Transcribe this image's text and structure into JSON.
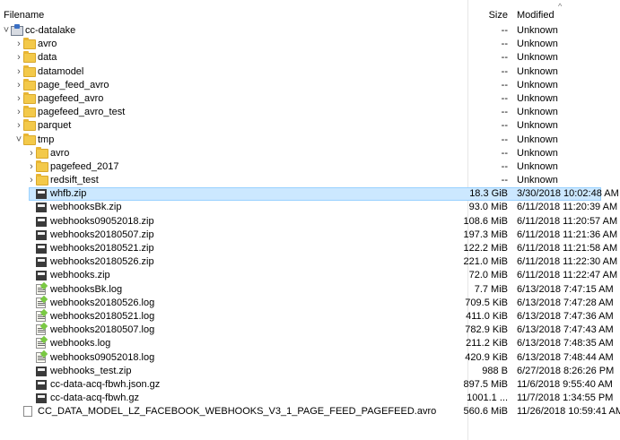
{
  "header": {
    "filename_label": "Filename",
    "size_label": "Size",
    "modified_label": "Modified",
    "sort_indicator": "^"
  },
  "rows": [
    {
      "depth": 0,
      "expand": "down",
      "icon": "drive-icon",
      "name": "cc-datalake",
      "size": "--",
      "modified": "Unknown"
    },
    {
      "depth": 1,
      "expand": "right",
      "icon": "folder-icon",
      "name": "avro",
      "size": "--",
      "modified": "Unknown"
    },
    {
      "depth": 1,
      "expand": "right",
      "icon": "folder-icon",
      "name": "data",
      "size": "--",
      "modified": "Unknown"
    },
    {
      "depth": 1,
      "expand": "right",
      "icon": "folder-icon",
      "name": "datamodel",
      "size": "--",
      "modified": "Unknown"
    },
    {
      "depth": 1,
      "expand": "right",
      "icon": "folder-icon",
      "name": "page_feed_avro",
      "size": "--",
      "modified": "Unknown"
    },
    {
      "depth": 1,
      "expand": "right",
      "icon": "folder-icon",
      "name": "pagefeed_avro",
      "size": "--",
      "modified": "Unknown"
    },
    {
      "depth": 1,
      "expand": "right",
      "icon": "folder-icon",
      "name": "pagefeed_avro_test",
      "size": "--",
      "modified": "Unknown"
    },
    {
      "depth": 1,
      "expand": "right",
      "icon": "folder-icon",
      "name": "parquet",
      "size": "--",
      "modified": "Unknown"
    },
    {
      "depth": 1,
      "expand": "down",
      "icon": "folder-icon",
      "name": "tmp",
      "size": "--",
      "modified": "Unknown"
    },
    {
      "depth": 2,
      "expand": "right",
      "icon": "folder-icon",
      "name": "avro",
      "size": "--",
      "modified": "Unknown"
    },
    {
      "depth": 2,
      "expand": "right",
      "icon": "folder-icon",
      "name": "pagefeed_2017",
      "size": "--",
      "modified": "Unknown"
    },
    {
      "depth": 2,
      "expand": "right",
      "icon": "folder-icon",
      "name": "redsift_test",
      "size": "--",
      "modified": "Unknown"
    },
    {
      "depth": 2,
      "expand": "",
      "icon": "zip-icon",
      "name": "whfb.zip",
      "size": "18.3 GiB",
      "modified": "3/30/2018 10:02:48 AM",
      "selected": true
    },
    {
      "depth": 2,
      "expand": "",
      "icon": "zip-icon",
      "name": "webhooksBk.zip",
      "size": "93.0 MiB",
      "modified": "6/11/2018 11:20:39 AM"
    },
    {
      "depth": 2,
      "expand": "",
      "icon": "zip-icon",
      "name": "webhooks09052018.zip",
      "size": "108.6 MiB",
      "modified": "6/11/2018 11:20:57 AM"
    },
    {
      "depth": 2,
      "expand": "",
      "icon": "zip-icon",
      "name": "webhooks20180507.zip",
      "size": "197.3 MiB",
      "modified": "6/11/2018 11:21:36 AM"
    },
    {
      "depth": 2,
      "expand": "",
      "icon": "zip-icon",
      "name": "webhooks20180521.zip",
      "size": "122.2 MiB",
      "modified": "6/11/2018 11:21:58 AM"
    },
    {
      "depth": 2,
      "expand": "",
      "icon": "zip-icon",
      "name": "webhooks20180526.zip",
      "size": "221.0 MiB",
      "modified": "6/11/2018 11:22:30 AM"
    },
    {
      "depth": 2,
      "expand": "",
      "icon": "zip-icon",
      "name": "webhooks.zip",
      "size": "72.0 MiB",
      "modified": "6/11/2018 11:22:47 AM"
    },
    {
      "depth": 2,
      "expand": "",
      "icon": "log-icon",
      "name": "webhooksBk.log",
      "size": "7.7 MiB",
      "modified": "6/13/2018 7:47:15 AM"
    },
    {
      "depth": 2,
      "expand": "",
      "icon": "log-icon",
      "name": "webhooks20180526.log",
      "size": "709.5 KiB",
      "modified": "6/13/2018 7:47:28 AM"
    },
    {
      "depth": 2,
      "expand": "",
      "icon": "log-icon",
      "name": "webhooks20180521.log",
      "size": "411.0 KiB",
      "modified": "6/13/2018 7:47:36 AM"
    },
    {
      "depth": 2,
      "expand": "",
      "icon": "log-icon",
      "name": "webhooks20180507.log",
      "size": "782.9 KiB",
      "modified": "6/13/2018 7:47:43 AM"
    },
    {
      "depth": 2,
      "expand": "",
      "icon": "log-icon",
      "name": "webhooks.log",
      "size": "211.2 KiB",
      "modified": "6/13/2018 7:48:35 AM"
    },
    {
      "depth": 2,
      "expand": "",
      "icon": "log-icon",
      "name": "webhooks09052018.log",
      "size": "420.9 KiB",
      "modified": "6/13/2018 7:48:44 AM"
    },
    {
      "depth": 2,
      "expand": "",
      "icon": "zip-icon",
      "name": "webhooks_test.zip",
      "size": "988 B",
      "modified": "6/27/2018 8:26:26 PM"
    },
    {
      "depth": 2,
      "expand": "",
      "icon": "zip-icon",
      "name": "cc-data-acq-fbwh.json.gz",
      "size": "897.5 MiB",
      "modified": "11/6/2018 9:55:40 AM"
    },
    {
      "depth": 2,
      "expand": "",
      "icon": "zip-icon",
      "name": "cc-data-acq-fbwh.gz",
      "size": "1001.1 ...",
      "modified": "11/7/2018 1:34:55 PM"
    },
    {
      "depth": 1,
      "expand": "",
      "icon": "file-icon",
      "name": "CC_DATA_MODEL_LZ_FACEBOOK_WEBHOOKS_V3_1_PAGE_FEED_PAGEFEED.avro",
      "size": "560.6 MiB",
      "modified": "11/26/2018 10:59:41 AM"
    }
  ]
}
